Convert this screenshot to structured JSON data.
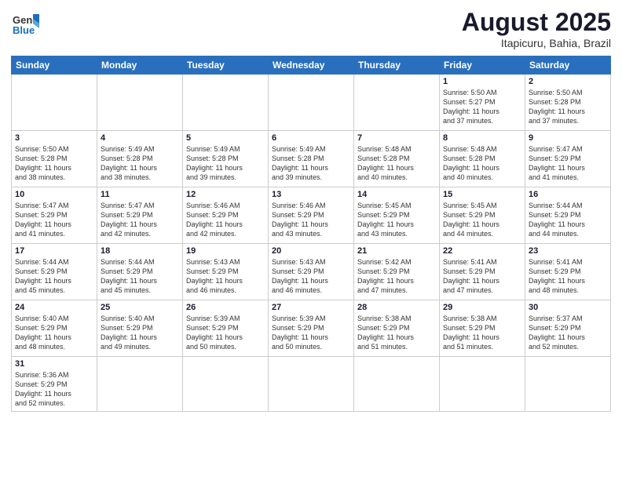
{
  "header": {
    "logo_general": "General",
    "logo_blue": "Blue",
    "month_year": "August 2025",
    "location": "Itapicuru, Bahia, Brazil"
  },
  "weekdays": [
    "Sunday",
    "Monday",
    "Tuesday",
    "Wednesday",
    "Thursday",
    "Friday",
    "Saturday"
  ],
  "weeks": [
    [
      {
        "day": "",
        "info": ""
      },
      {
        "day": "",
        "info": ""
      },
      {
        "day": "",
        "info": ""
      },
      {
        "day": "",
        "info": ""
      },
      {
        "day": "",
        "info": ""
      },
      {
        "day": "1",
        "info": "Sunrise: 5:50 AM\nSunset: 5:27 PM\nDaylight: 11 hours\nand 37 minutes."
      },
      {
        "day": "2",
        "info": "Sunrise: 5:50 AM\nSunset: 5:28 PM\nDaylight: 11 hours\nand 37 minutes."
      }
    ],
    [
      {
        "day": "3",
        "info": "Sunrise: 5:50 AM\nSunset: 5:28 PM\nDaylight: 11 hours\nand 38 minutes."
      },
      {
        "day": "4",
        "info": "Sunrise: 5:49 AM\nSunset: 5:28 PM\nDaylight: 11 hours\nand 38 minutes."
      },
      {
        "day": "5",
        "info": "Sunrise: 5:49 AM\nSunset: 5:28 PM\nDaylight: 11 hours\nand 39 minutes."
      },
      {
        "day": "6",
        "info": "Sunrise: 5:49 AM\nSunset: 5:28 PM\nDaylight: 11 hours\nand 39 minutes."
      },
      {
        "day": "7",
        "info": "Sunrise: 5:48 AM\nSunset: 5:28 PM\nDaylight: 11 hours\nand 40 minutes."
      },
      {
        "day": "8",
        "info": "Sunrise: 5:48 AM\nSunset: 5:28 PM\nDaylight: 11 hours\nand 40 minutes."
      },
      {
        "day": "9",
        "info": "Sunrise: 5:47 AM\nSunset: 5:29 PM\nDaylight: 11 hours\nand 41 minutes."
      }
    ],
    [
      {
        "day": "10",
        "info": "Sunrise: 5:47 AM\nSunset: 5:29 PM\nDaylight: 11 hours\nand 41 minutes."
      },
      {
        "day": "11",
        "info": "Sunrise: 5:47 AM\nSunset: 5:29 PM\nDaylight: 11 hours\nand 42 minutes."
      },
      {
        "day": "12",
        "info": "Sunrise: 5:46 AM\nSunset: 5:29 PM\nDaylight: 11 hours\nand 42 minutes."
      },
      {
        "day": "13",
        "info": "Sunrise: 5:46 AM\nSunset: 5:29 PM\nDaylight: 11 hours\nand 43 minutes."
      },
      {
        "day": "14",
        "info": "Sunrise: 5:45 AM\nSunset: 5:29 PM\nDaylight: 11 hours\nand 43 minutes."
      },
      {
        "day": "15",
        "info": "Sunrise: 5:45 AM\nSunset: 5:29 PM\nDaylight: 11 hours\nand 44 minutes."
      },
      {
        "day": "16",
        "info": "Sunrise: 5:44 AM\nSunset: 5:29 PM\nDaylight: 11 hours\nand 44 minutes."
      }
    ],
    [
      {
        "day": "17",
        "info": "Sunrise: 5:44 AM\nSunset: 5:29 PM\nDaylight: 11 hours\nand 45 minutes."
      },
      {
        "day": "18",
        "info": "Sunrise: 5:44 AM\nSunset: 5:29 PM\nDaylight: 11 hours\nand 45 minutes."
      },
      {
        "day": "19",
        "info": "Sunrise: 5:43 AM\nSunset: 5:29 PM\nDaylight: 11 hours\nand 46 minutes."
      },
      {
        "day": "20",
        "info": "Sunrise: 5:43 AM\nSunset: 5:29 PM\nDaylight: 11 hours\nand 46 minutes."
      },
      {
        "day": "21",
        "info": "Sunrise: 5:42 AM\nSunset: 5:29 PM\nDaylight: 11 hours\nand 47 minutes."
      },
      {
        "day": "22",
        "info": "Sunrise: 5:41 AM\nSunset: 5:29 PM\nDaylight: 11 hours\nand 47 minutes."
      },
      {
        "day": "23",
        "info": "Sunrise: 5:41 AM\nSunset: 5:29 PM\nDaylight: 11 hours\nand 48 minutes."
      }
    ],
    [
      {
        "day": "24",
        "info": "Sunrise: 5:40 AM\nSunset: 5:29 PM\nDaylight: 11 hours\nand 48 minutes."
      },
      {
        "day": "25",
        "info": "Sunrise: 5:40 AM\nSunset: 5:29 PM\nDaylight: 11 hours\nand 49 minutes."
      },
      {
        "day": "26",
        "info": "Sunrise: 5:39 AM\nSunset: 5:29 PM\nDaylight: 11 hours\nand 50 minutes."
      },
      {
        "day": "27",
        "info": "Sunrise: 5:39 AM\nSunset: 5:29 PM\nDaylight: 11 hours\nand 50 minutes."
      },
      {
        "day": "28",
        "info": "Sunrise: 5:38 AM\nSunset: 5:29 PM\nDaylight: 11 hours\nand 51 minutes."
      },
      {
        "day": "29",
        "info": "Sunrise: 5:38 AM\nSunset: 5:29 PM\nDaylight: 11 hours\nand 51 minutes."
      },
      {
        "day": "30",
        "info": "Sunrise: 5:37 AM\nSunset: 5:29 PM\nDaylight: 11 hours\nand 52 minutes."
      }
    ],
    [
      {
        "day": "31",
        "info": "Sunrise: 5:36 AM\nSunset: 5:29 PM\nDaylight: 11 hours\nand 52 minutes."
      },
      {
        "day": "",
        "info": ""
      },
      {
        "day": "",
        "info": ""
      },
      {
        "day": "",
        "info": ""
      },
      {
        "day": "",
        "info": ""
      },
      {
        "day": "",
        "info": ""
      },
      {
        "day": "",
        "info": ""
      }
    ]
  ]
}
